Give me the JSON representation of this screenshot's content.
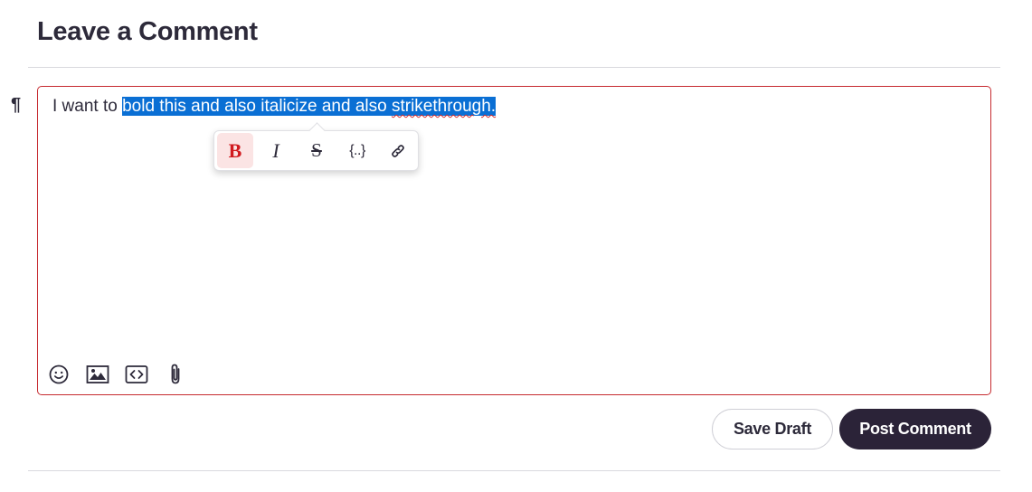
{
  "header": {
    "title": "Leave a Comment"
  },
  "editor": {
    "paragraph_mark": "¶",
    "text_before": "I want to ",
    "selected_text_1": "bold this and also italicize and also ",
    "selected_misspelled": "strikethrough.",
    "accent_color": "#c62a2f",
    "selection_color": "#0a6fd4"
  },
  "format_toolbar": {
    "bold_label": "B",
    "italic_label": "I",
    "strike_label": "S",
    "code_label": "{..}",
    "active": "bold"
  },
  "attach_toolbar": {
    "icons": [
      "emoji-icon",
      "image-icon",
      "code-embed-icon",
      "paperclip-icon"
    ]
  },
  "actions": {
    "save_draft_label": "Save Draft",
    "post_comment_label": "Post Comment",
    "primary_color": "#2b2338"
  }
}
